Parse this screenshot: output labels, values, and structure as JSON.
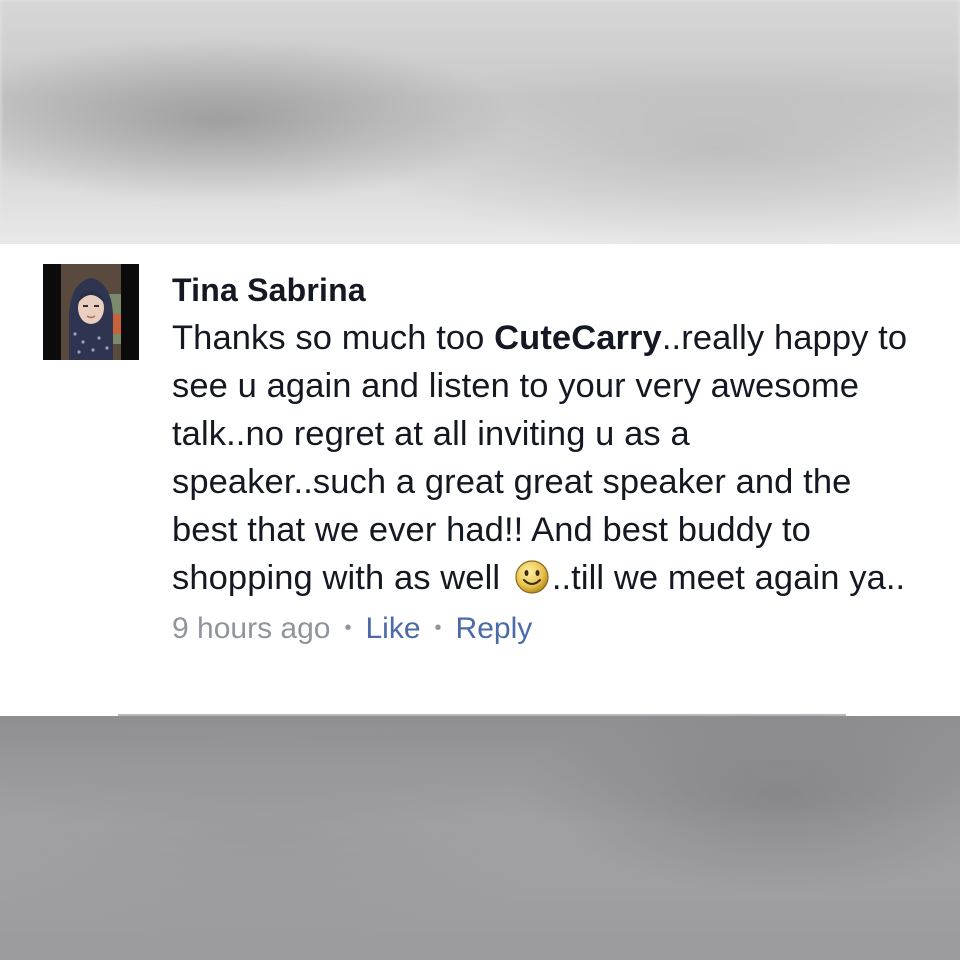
{
  "comment": {
    "author": "Tina Sabrina",
    "text_before_mention": "Thanks so much too ",
    "mention": "CuteCarry",
    "text_after_mention": "..really happy to see u again and listen to your very awesome talk..no regret at all inviting u as a speaker..such a great great speaker and the best that we ever had!! And best buddy to shopping with as well ",
    "emoji_icon": "smiley-face-icon",
    "text_after_emoji": "..till we meet again ya..",
    "timestamp": "9 hours ago",
    "like_label": "Like",
    "reply_label": "Reply",
    "separator": "•"
  },
  "colors": {
    "author_text": "#141823",
    "meta_text": "#90949c",
    "action_link": "#4b6ba8",
    "card_background": "#ffffff"
  }
}
